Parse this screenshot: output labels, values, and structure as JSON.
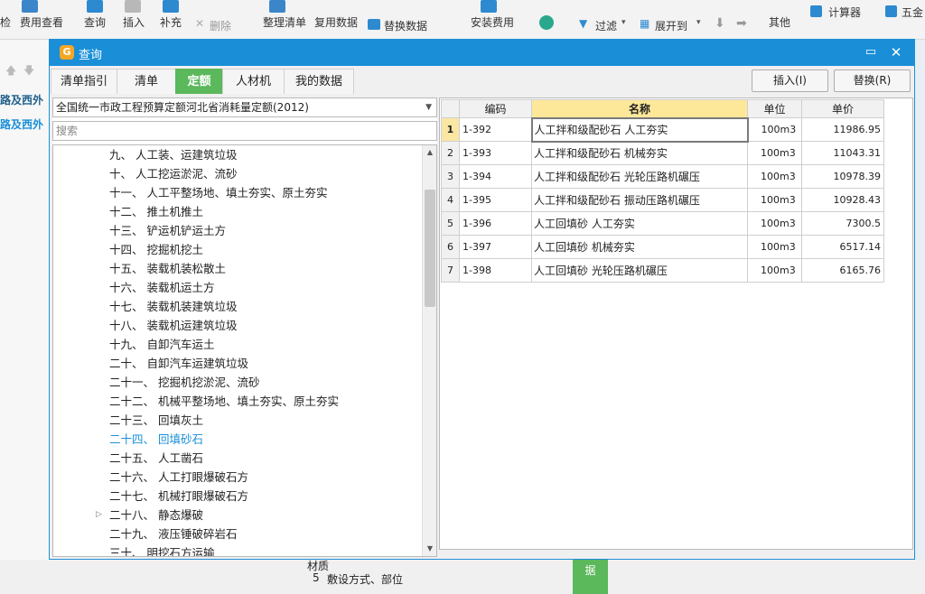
{
  "ribbon": {
    "check": "检",
    "fee_view": "费用查看",
    "query": "查询",
    "insert": "插入",
    "supplement": "补充",
    "delete": "删除",
    "organize_list": "整理清单",
    "reuse_data": "复用数据",
    "replace_data": "替换数据",
    "install_fee": "安装费用",
    "filter": "过滤",
    "expand_to": "展开到",
    "other": "其他",
    "calculator": "计算器",
    "wujin": "五金",
    "row_move_up": "🡅",
    "row_move_down": "🡇"
  },
  "background": {
    "left_item1": "路及西外",
    "left_item2": "路及西外",
    "row5_num": "5",
    "row5_label": "敷设方式、部位",
    "row4_label": "材质",
    "green_btn": "据"
  },
  "dialog": {
    "title": "查询",
    "max_icon": "▭",
    "close_icon": "✕",
    "tabs": [
      {
        "label": "清单指引",
        "active": false
      },
      {
        "label": "清单",
        "active": false
      },
      {
        "label": "定额",
        "active": true
      },
      {
        "label": "人材机",
        "active": false
      },
      {
        "label": "我的数据",
        "active": false
      }
    ],
    "insert_button": "插入(I)",
    "replace_button": "替换(R)",
    "quota_selector": "全国统一市政工程预算定额河北省消耗量定额(2012)",
    "search_placeholder": "搜索",
    "tree": [
      {
        "label": "九、 人工装、运建筑垃圾",
        "selected": false,
        "expandable": false
      },
      {
        "label": "十、 人工挖运淤泥、流砂",
        "selected": false,
        "expandable": false
      },
      {
        "label": "十一、 人工平整场地、填土夯实、原土夯实",
        "selected": false,
        "expandable": false
      },
      {
        "label": "十二、 推土机推土",
        "selected": false,
        "expandable": false
      },
      {
        "label": "十三、 铲运机铲运土方",
        "selected": false,
        "expandable": false
      },
      {
        "label": "十四、 挖掘机挖土",
        "selected": false,
        "expandable": false
      },
      {
        "label": "十五、 装载机装松散土",
        "selected": false,
        "expandable": false
      },
      {
        "label": "十六、 装载机运土方",
        "selected": false,
        "expandable": false
      },
      {
        "label": "十七、 装载机装建筑垃圾",
        "selected": false,
        "expandable": false
      },
      {
        "label": "十八、 装载机运建筑垃圾",
        "selected": false,
        "expandable": false
      },
      {
        "label": "十九、 自卸汽车运土",
        "selected": false,
        "expandable": false
      },
      {
        "label": "二十、 自卸汽车运建筑垃圾",
        "selected": false,
        "expandable": false
      },
      {
        "label": "二十一、 挖掘机挖淤泥、流砂",
        "selected": false,
        "expandable": false
      },
      {
        "label": "二十二、 机械平整场地、填土夯实、原土夯实",
        "selected": false,
        "expandable": false
      },
      {
        "label": "二十三、 回填灰土",
        "selected": false,
        "expandable": false
      },
      {
        "label": "二十四、 回填砂石",
        "selected": true,
        "expandable": false
      },
      {
        "label": "二十五、 人工凿石",
        "selected": false,
        "expandable": false
      },
      {
        "label": "二十六、 人工打眼爆破石方",
        "selected": false,
        "expandable": false
      },
      {
        "label": "二十七、 机械打眼爆破石方",
        "selected": false,
        "expandable": false
      },
      {
        "label": "二十八、 静态爆破",
        "selected": false,
        "expandable": true
      },
      {
        "label": "二十九、 液压锤破碎岩石",
        "selected": false,
        "expandable": false
      },
      {
        "label": "三十、 明挖石方运输",
        "selected": false,
        "expandable": false
      }
    ],
    "table": {
      "headers": [
        "",
        "编码",
        "名称",
        "单位",
        "单价"
      ],
      "rows": [
        {
          "num": "1",
          "code": "1-392",
          "name": "人工拌和级配砂石 人工夯实",
          "unit": "100m3",
          "price": "11986.95"
        },
        {
          "num": "2",
          "code": "1-393",
          "name": "人工拌和级配砂石 机械夯实",
          "unit": "100m3",
          "price": "11043.31"
        },
        {
          "num": "3",
          "code": "1-394",
          "name": "人工拌和级配砂石 光轮压路机碾压",
          "unit": "100m3",
          "price": "10978.39"
        },
        {
          "num": "4",
          "code": "1-395",
          "name": "人工拌和级配砂石 振动压路机碾压",
          "unit": "100m3",
          "price": "10928.43"
        },
        {
          "num": "5",
          "code": "1-396",
          "name": "人工回填砂 人工夯实",
          "unit": "100m3",
          "price": "7300.5"
        },
        {
          "num": "6",
          "code": "1-397",
          "name": "人工回填砂 机械夯实",
          "unit": "100m3",
          "price": "6517.14"
        },
        {
          "num": "7",
          "code": "1-398",
          "name": "人工回填砂 光轮压路机碾压",
          "unit": "100m3",
          "price": "6165.76"
        }
      ]
    }
  }
}
